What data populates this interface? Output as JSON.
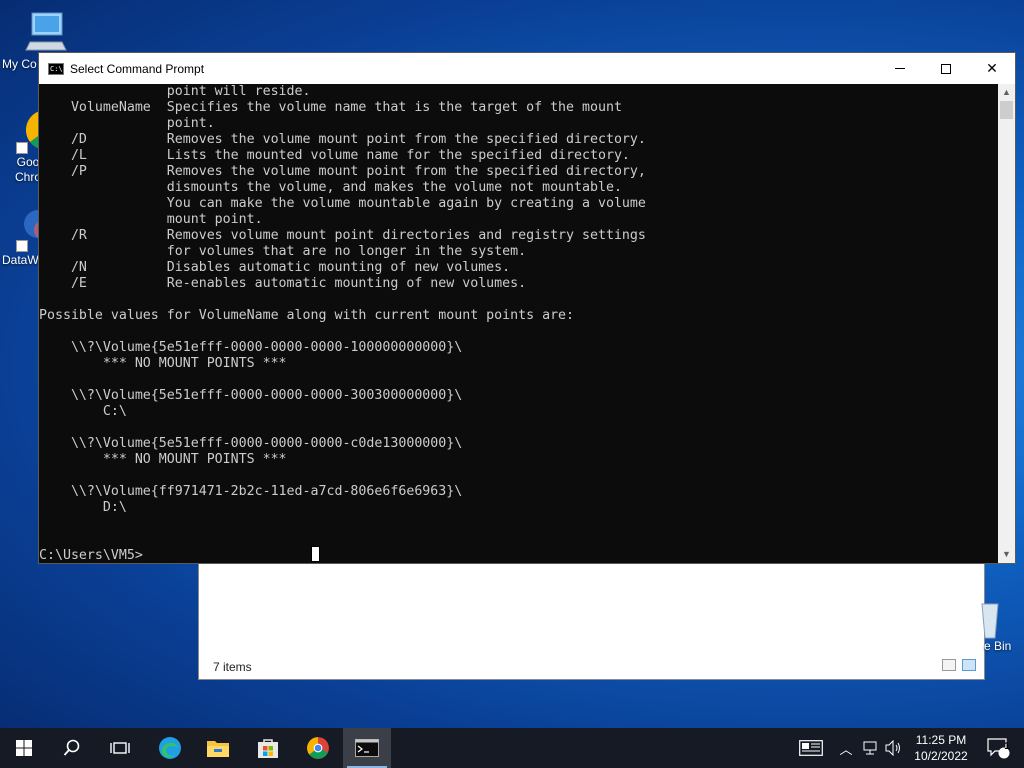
{
  "desktop": {
    "icons": [
      {
        "label": "My Co",
        "icon": "computer-icon"
      },
      {
        "label": "Goo Chro",
        "icon": "chrome-icon"
      },
      {
        "label": "DataW",
        "icon": "app-icon"
      },
      {
        "label": "e Bin",
        "icon": "recycle-bin-icon"
      }
    ]
  },
  "explorer": {
    "status": "7 items"
  },
  "cmd": {
    "title": "Select Command Prompt",
    "lines": [
      "                point will reside.",
      "    VolumeName  Specifies the volume name that is the target of the mount",
      "                point.",
      "    /D          Removes the volume mount point from the specified directory.",
      "    /L          Lists the mounted volume name for the specified directory.",
      "    /P          Removes the volume mount point from the specified directory,",
      "                dismounts the volume, and makes the volume not mountable.",
      "                You can make the volume mountable again by creating a volume",
      "                mount point.",
      "    /R          Removes volume mount point directories and registry settings",
      "                for volumes that are no longer in the system.",
      "    /N          Disables automatic mounting of new volumes.",
      "    /E          Re-enables automatic mounting of new volumes.",
      "",
      "Possible values for VolumeName along with current mount points are:",
      "",
      "    \\\\?\\Volume{5e51efff-0000-0000-0000-100000000000}\\",
      "        *** NO MOUNT POINTS ***",
      "",
      "    \\\\?\\Volume{5e51efff-0000-0000-0000-300300000000}\\",
      "        C:\\",
      "",
      "    \\\\?\\Volume{5e51efff-0000-0000-0000-c0de13000000}\\",
      "        *** NO MOUNT POINTS ***",
      "",
      "    \\\\?\\Volume{ff971471-2b2c-11ed-a7cd-806e6f6e6963}\\",
      "        D:\\",
      "",
      "",
      "C:\\Users\\VM5>"
    ]
  },
  "taskbar": {
    "apps": [
      "start-icon",
      "search-icon",
      "task-view-icon",
      "edge-icon",
      "file-explorer-icon",
      "store-icon",
      "chrome-icon",
      "command-prompt-icon"
    ],
    "clock_time": "11:25 PM",
    "clock_date": "10/2/2022",
    "notification_count": "1"
  },
  "colors": {
    "console_bg": "#0c0c0c",
    "console_text": "#cccccc",
    "taskbar": "#151a24"
  }
}
